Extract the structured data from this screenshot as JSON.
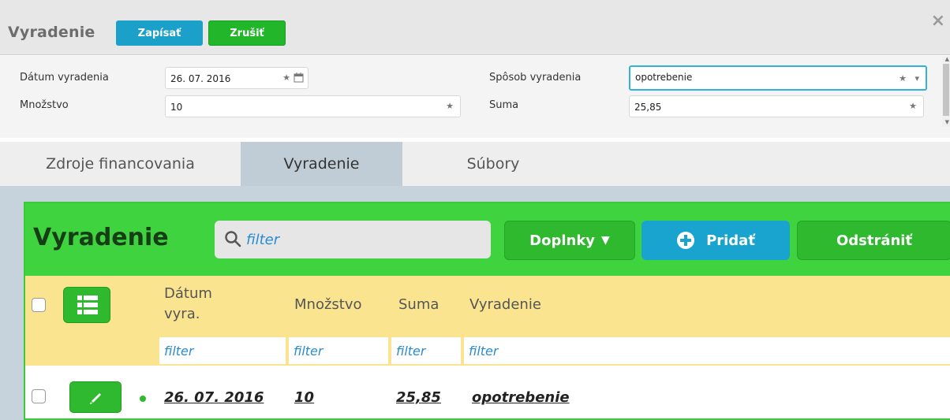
{
  "modal": {
    "title": "Vyradenie",
    "save_label": "Zapísať",
    "cancel_label": "Zrušiť",
    "close_glyph": "×"
  },
  "form": {
    "date_label": "Dátum vyradenia",
    "date_value": "26. 07. 2016",
    "method_label": "Spôsob vyradenia",
    "method_value": "opotrebenie",
    "qty_label": "Množstvo",
    "qty_value": "10",
    "sum_label": "Suma",
    "sum_value": "25,85"
  },
  "tabs": [
    {
      "label": "Zdroje financovania",
      "active": false
    },
    {
      "label": "Vyradenie",
      "active": true
    },
    {
      "label": "Súbory",
      "active": false
    }
  ],
  "panel": {
    "title": "Vyradenie",
    "search_placeholder": "filter",
    "addons_label": "Doplnky",
    "add_label": "Pridať",
    "remove_label": "Odstrániť"
  },
  "table": {
    "columns": [
      "Dátum vyra.",
      "Množstvo",
      "Suma",
      "Vyradenie"
    ],
    "filter_placeholder": "filter",
    "rows": [
      {
        "date": "26. 07. 2016",
        "qty": "10",
        "sum": "25,85",
        "method": "opotrebenie"
      }
    ]
  },
  "colors": {
    "accent_blue": "#1aa0c9",
    "accent_green": "#3fd33f",
    "header_yellow": "#fbe48f"
  }
}
